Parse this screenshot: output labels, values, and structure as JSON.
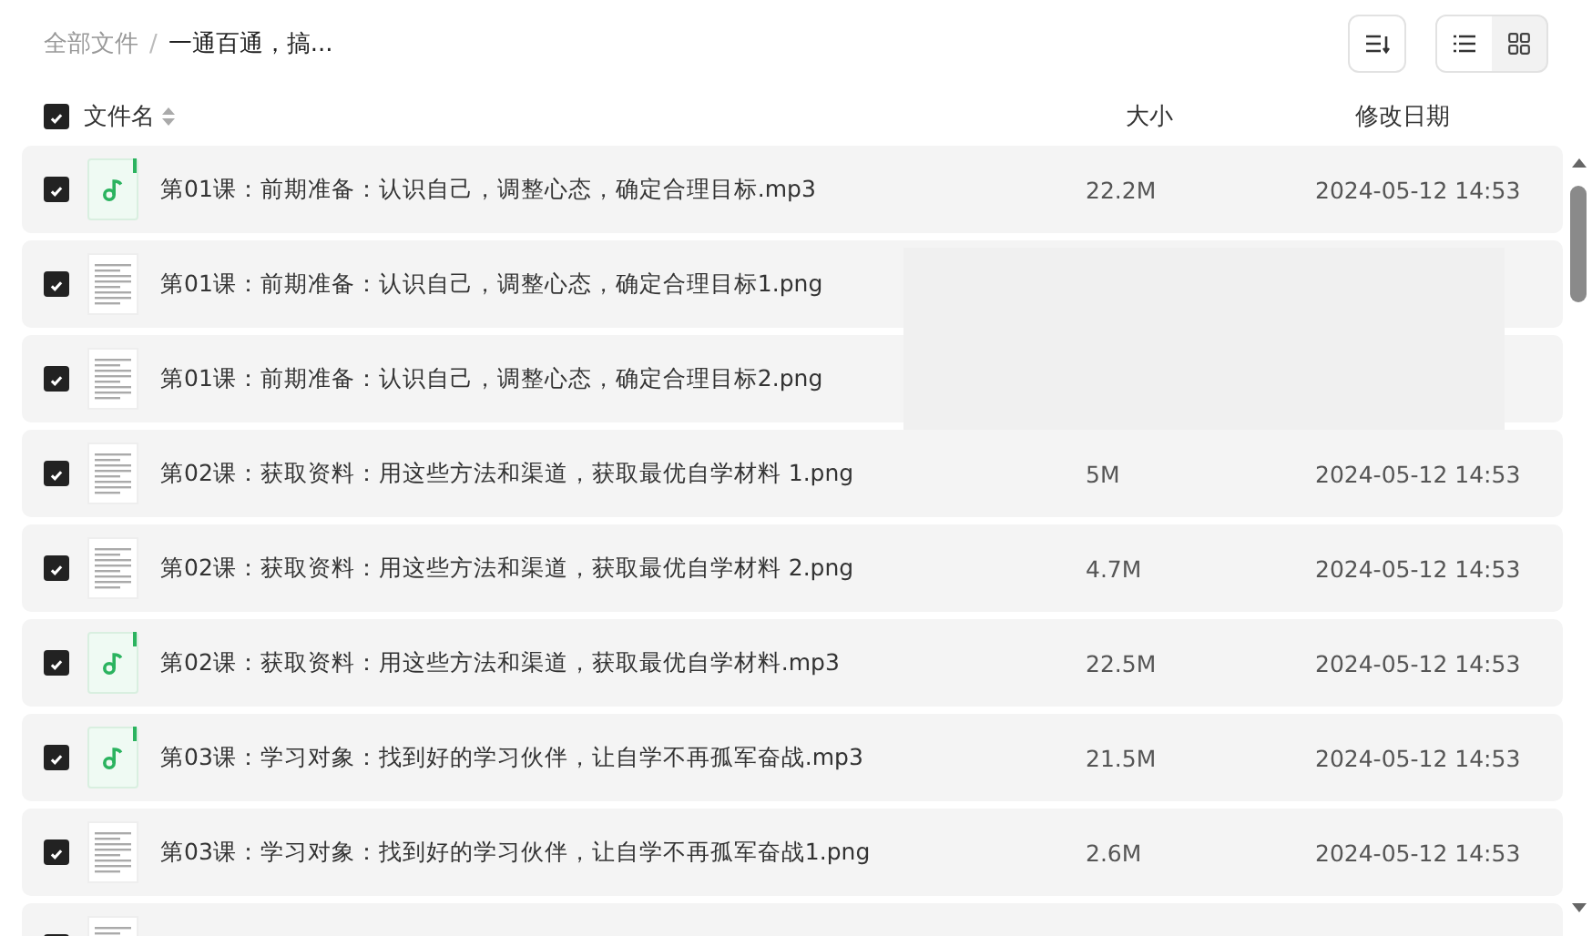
{
  "breadcrumb": [
    {
      "label": "全部文件"
    },
    {
      "label": "一通百通，搞..."
    }
  ],
  "breadcrumb_separator": "/",
  "toolbar": {
    "view_modes": [
      {
        "kind": "list",
        "selected": true
      },
      {
        "kind": "grid",
        "selected": false
      }
    ]
  },
  "table": {
    "select_all": {
      "checked": true
    },
    "columns": [
      {
        "label": "文件名",
        "sortable": true
      },
      {
        "label": "大小",
        "sortable": false
      },
      {
        "label": "修改日期",
        "sortable": false
      }
    ],
    "rows": [
      {
        "kind": "audio",
        "checked": true,
        "name": "第01课：前期准备：认识自己，调整心态，确定合理目标.mp3",
        "size": "22.2M",
        "date": "2024-05-12 14:53"
      },
      {
        "kind": "image",
        "checked": true,
        "name": "第01课：前期准备：认识自己，调整心态，确定合理目标1.png",
        "redacted": true
      },
      {
        "kind": "image",
        "checked": true,
        "name": "第01课：前期准备：认识自己，调整心态，确定合理目标2.png",
        "redacted": true
      },
      {
        "kind": "image",
        "checked": true,
        "name": "第02课：获取资料：用这些方法和渠道，获取最优自学材料 1.png",
        "size": "5M",
        "date": "2024-05-12 14:53"
      },
      {
        "kind": "image",
        "checked": true,
        "name": "第02课：获取资料：用这些方法和渠道，获取最优自学材料 2.png",
        "size": "4.7M",
        "date": "2024-05-12 14:53"
      },
      {
        "kind": "audio",
        "checked": true,
        "name": "第02课：获取资料：用这些方法和渠道，获取最优自学材料.mp3",
        "size": "22.5M",
        "date": "2024-05-12 14:53"
      },
      {
        "kind": "audio",
        "checked": true,
        "name": "第03课：学习对象：找到好的学习伙伴，让自学不再孤军奋战.mp3",
        "size": "21.5M",
        "date": "2024-05-12 14:53"
      },
      {
        "kind": "image",
        "checked": true,
        "name": "第03课：学习对象：找到好的学习伙伴，让自学不再孤军奋战1.png",
        "size": "2.6M",
        "date": "2024-05-12 14:53"
      },
      {
        "kind": "image",
        "checked": true
      }
    ]
  }
}
